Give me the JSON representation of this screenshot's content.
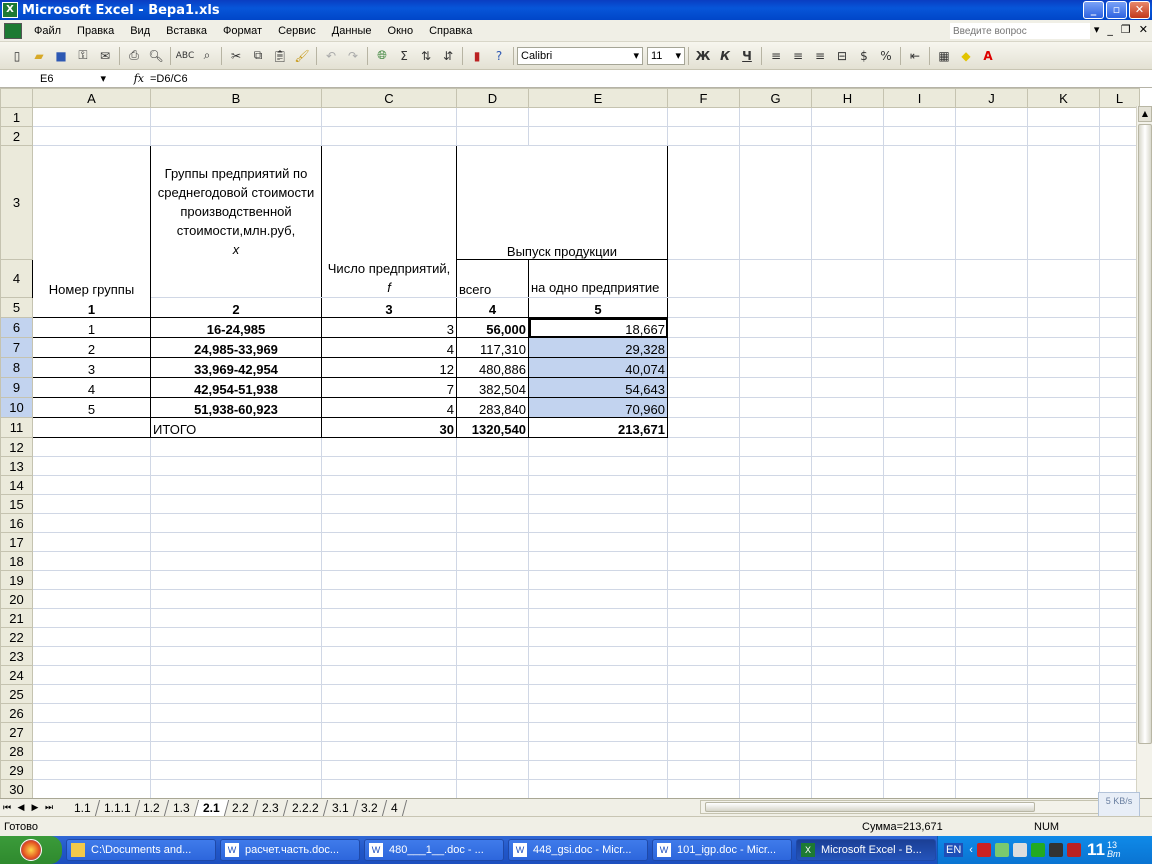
{
  "window": {
    "title": "Microsoft Excel - Вера1.xls",
    "app_icon": "excel-icon"
  },
  "menu": {
    "items": [
      "Файл",
      "Правка",
      "Вид",
      "Вставка",
      "Формат",
      "Сервис",
      "Данные",
      "Окно",
      "Справка"
    ],
    "ask_placeholder": "Введите вопрос"
  },
  "toolbar": {
    "font_name": "Calibri",
    "font_size": "11",
    "bold": "Ж",
    "italic": "К",
    "underline": "Ч"
  },
  "formula_bar": {
    "name_box": "E6",
    "fx": "fx",
    "formula": "=D6/C6"
  },
  "columns": [
    "A",
    "B",
    "C",
    "D",
    "E",
    "F",
    "G",
    "H",
    "I",
    "J",
    "K",
    "L"
  ],
  "rows": [
    "1",
    "2",
    "3",
    "4",
    "5",
    "6",
    "7",
    "8",
    "9",
    "10",
    "11",
    "12",
    "13",
    "14",
    "15",
    "16",
    "17",
    "18",
    "19",
    "20",
    "21",
    "22",
    "23",
    "24",
    "25",
    "26",
    "27",
    "28",
    "29",
    "30"
  ],
  "table": {
    "header_a": "Номер группы",
    "header_b": "Группы предприятий по среднегодовой стоимости производственной стоимости,млн.руб,",
    "header_b_var": "x",
    "header_c": "Число предприятий,",
    "header_c_var": "f",
    "header_de": "Выпуск продукции",
    "header_d": "всего",
    "header_e": "на одно предприятие",
    "colnums": [
      "1",
      "2",
      "3",
      "4",
      "5"
    ],
    "rows": [
      {
        "a": "1",
        "b": "16-24,985",
        "c": "3",
        "d": "56,000",
        "e": "18,667"
      },
      {
        "a": "2",
        "b": "24,985-33,969",
        "c": "4",
        "d": "117,310",
        "e": "29,328"
      },
      {
        "a": "3",
        "b": "33,969-42,954",
        "c": "12",
        "d": "480,886",
        "e": "40,074"
      },
      {
        "a": "4",
        "b": "42,954-51,938",
        "c": "7",
        "d": "382,504",
        "e": "54,643"
      },
      {
        "a": "5",
        "b": "51,938-60,923",
        "c": "4",
        "d": "283,840",
        "e": "70,960"
      }
    ],
    "total": {
      "b": "ИТОГО",
      "c": "30",
      "d": "1320,540",
      "e": "213,671"
    }
  },
  "sheet_tabs": [
    "1.1",
    "1.1.1",
    "1.2",
    "1.3",
    "2.1",
    "2.2",
    "2.3",
    "2.2.2",
    "3.1",
    "3.2",
    "4"
  ],
  "active_tab": "2.1",
  "status": {
    "left": "Готово",
    "sum": "Сумма=213,671",
    "num": "NUM"
  },
  "taskbar": {
    "tasks": [
      "C:\\Documents and...",
      "расчет.часть.doc...",
      "480___1__.doc - ...",
      "448_gsi.doc - Micr...",
      "101_igp.doc - Micr...",
      "Microsoft Excel - В..."
    ],
    "lang": "EN",
    "clock": "11",
    "clock_min": "13",
    "clock_day": "Вт"
  },
  "net_widget": "5 KB/s"
}
